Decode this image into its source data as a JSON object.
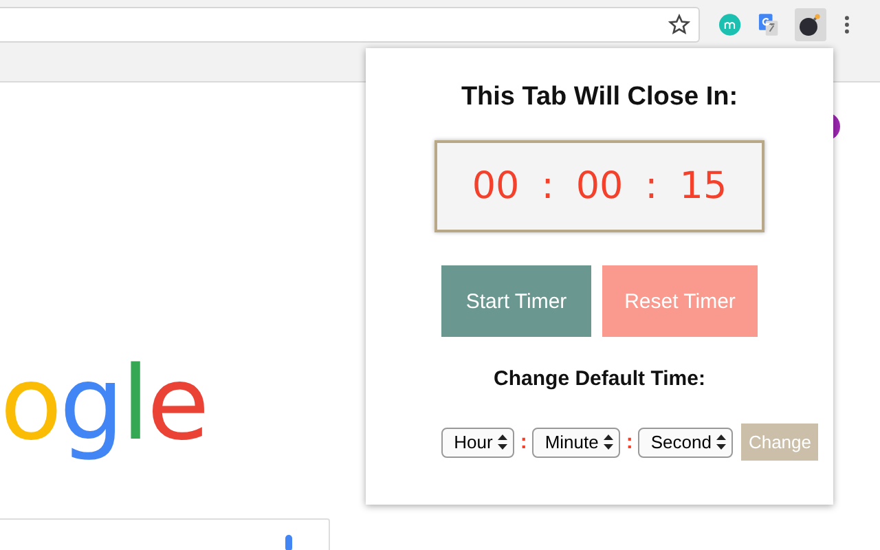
{
  "page": {
    "logo_letters": [
      {
        "text": "o",
        "color": "#fbbc05"
      },
      {
        "text": "g",
        "color": "#4285f4"
      },
      {
        "text": "l",
        "color": "#34a853"
      },
      {
        "text": "e",
        "color": "#ea4335"
      }
    ]
  },
  "popup": {
    "title": "This Tab Will Close In:",
    "timer": {
      "hours": "00",
      "separator_1": ":",
      "minutes": "00",
      "separator_2": ":",
      "seconds": "15"
    },
    "buttons": [
      {
        "label": "Start Timer",
        "kind": "start"
      },
      {
        "label": "Reset Timer",
        "kind": "reset"
      }
    ],
    "section_title": "Change Default Time:",
    "selects": [
      {
        "value": "Hour"
      },
      {
        "value": "Minute"
      },
      {
        "value": "Second"
      }
    ],
    "select_separators": [
      ":",
      ":"
    ],
    "change_button": {
      "label": "Change",
      "disabled": true
    }
  }
}
